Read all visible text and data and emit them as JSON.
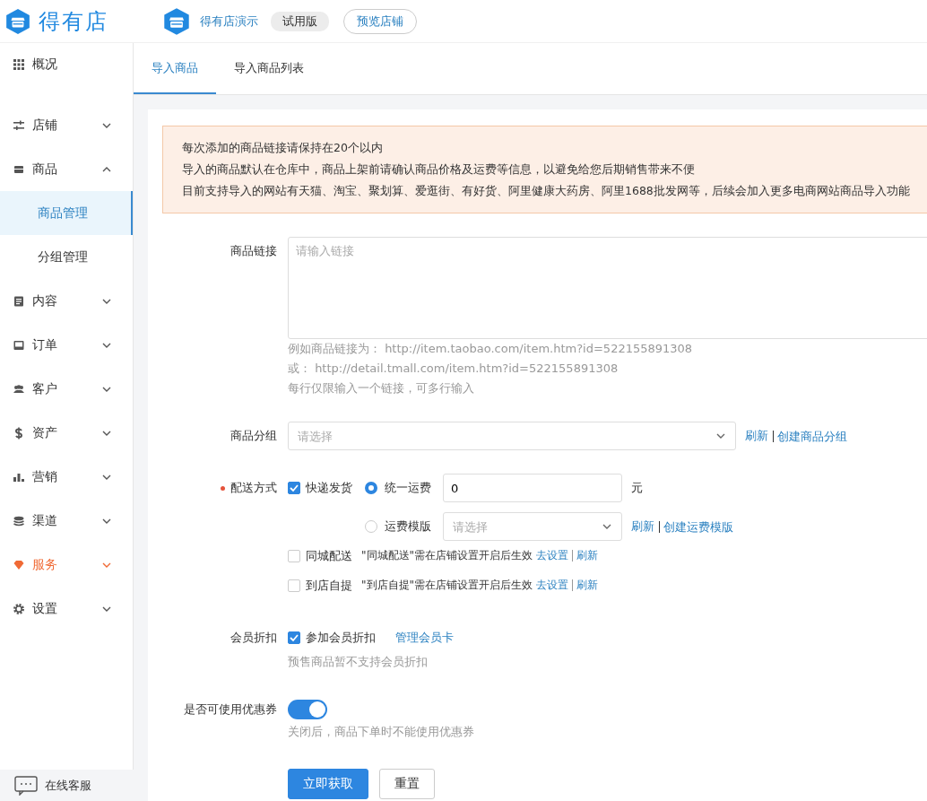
{
  "header": {
    "brand": "得有店",
    "store_name": "得有店演示",
    "plan_badge": "试用版",
    "preview_button": "预览店铺"
  },
  "sidebar": {
    "items": [
      {
        "kind": "link",
        "label": "概况",
        "highlighted": false
      },
      {
        "kind": "group",
        "label": "店铺",
        "expanded": false,
        "highlighted": false
      },
      {
        "kind": "group",
        "label": "商品",
        "expanded": true,
        "highlighted": false,
        "children": [
          {
            "label": "商品管理",
            "selected": true
          },
          {
            "label": "分组管理",
            "selected": false
          }
        ]
      },
      {
        "kind": "group",
        "label": "内容",
        "expanded": false,
        "highlighted": false
      },
      {
        "kind": "group",
        "label": "订单",
        "expanded": false,
        "highlighted": false
      },
      {
        "kind": "group",
        "label": "客户",
        "expanded": false,
        "highlighted": false
      },
      {
        "kind": "group",
        "label": "资产",
        "expanded": false,
        "highlighted": false
      },
      {
        "kind": "group",
        "label": "营销",
        "expanded": false,
        "highlighted": false
      },
      {
        "kind": "group",
        "label": "渠道",
        "expanded": false,
        "highlighted": false
      },
      {
        "kind": "group",
        "label": "服务",
        "expanded": false,
        "highlighted": true
      },
      {
        "kind": "group",
        "label": "设置",
        "expanded": false,
        "highlighted": false
      }
    ],
    "footer": "在线客服"
  },
  "tabs": [
    {
      "label": "导入商品",
      "selected": true
    },
    {
      "label": "导入商品列表",
      "selected": false
    }
  ],
  "notice": {
    "lines": [
      "每次添加的商品链接请保持在20个以内",
      "导入的商品默认在仓库中，商品上架前请确认商品价格及运费等信息，以避免给您后期销售带来不便",
      "目前支持导入的网站有天猫、淘宝、聚划算、爱逛街、有好货、阿里健康大药房、阿里1688批发网等，后续会加入更多电商网站商品导入功能"
    ]
  },
  "form": {
    "link_field": {
      "label": "商品链接",
      "placeholder": "请输入链接",
      "hints": [
        "例如商品链接为： http://item.taobao.com/item.htm?id=522155891308",
        "或： http://detail.tmall.com/item.htm?id=522155891308",
        "每行仅限输入一个链接，可多行输入"
      ]
    },
    "group_field": {
      "label": "商品分组",
      "placeholder": "请选择",
      "links": [
        "刷新",
        "创建商品分组"
      ]
    },
    "delivery": {
      "label": "配送方式",
      "required": true,
      "express": {
        "label": "快递发货",
        "checked": true
      },
      "fee_options": [
        {
          "kind": "fixed",
          "label": "统一运费",
          "selected": true,
          "value": "0",
          "unit": "元"
        },
        {
          "kind": "template",
          "label": "运费模版",
          "selected": false,
          "placeholder": "请选择",
          "links": [
            "刷新",
            "创建运费模版"
          ]
        }
      ],
      "other_methods": [
        {
          "label": "同城配送",
          "checked": false,
          "note": "\"同城配送\"需在店铺设置开启后生效",
          "links": [
            "去设置",
            "刷新"
          ]
        },
        {
          "label": "到店自提",
          "checked": false,
          "note": "\"到店自提\"需在店铺设置开启后生效",
          "links": [
            "去设置",
            "刷新"
          ]
        }
      ]
    },
    "member_discount": {
      "label": "会员折扣",
      "option": {
        "label": "参加会员折扣",
        "checked": true
      },
      "link": "管理会员卡",
      "hint": "预售商品暂不支持会员折扣"
    },
    "coupon": {
      "label": "是否可使用优惠券",
      "on": true,
      "hint": "关闭后，商品下单时不能使用优惠券"
    },
    "buttons": [
      {
        "kind": "primary",
        "label": "立即获取"
      },
      {
        "kind": "default",
        "label": "重置"
      }
    ]
  }
}
